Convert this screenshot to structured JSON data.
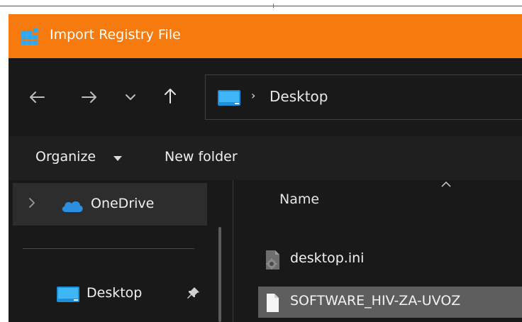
{
  "window": {
    "title": "Import Registry File",
    "accent_color": "#f77a0e"
  },
  "navigation": {
    "back_icon": "arrow-left-icon",
    "forward_icon": "arrow-right-icon",
    "recent_icon": "chevron-down-icon",
    "up_icon": "arrow-up-icon",
    "address": {
      "separator": "›",
      "location": "Desktop"
    }
  },
  "toolbar": {
    "organize_label": "Organize",
    "new_folder_label": "New folder"
  },
  "nav_pane": {
    "items": [
      {
        "label": "OneDrive",
        "icon": "cloud-icon",
        "selected": true
      },
      {
        "label": "Desktop",
        "icon": "desktop-folder-icon",
        "pinned": true
      }
    ]
  },
  "file_list": {
    "columns": [
      "Name"
    ],
    "files": [
      {
        "name": "desktop.ini",
        "icon": "settings-file-icon",
        "selected": false
      },
      {
        "name": "SOFTWARE_HIV-ZA-UVOZ",
        "icon": "blank-file-icon",
        "selected": true
      }
    ]
  }
}
